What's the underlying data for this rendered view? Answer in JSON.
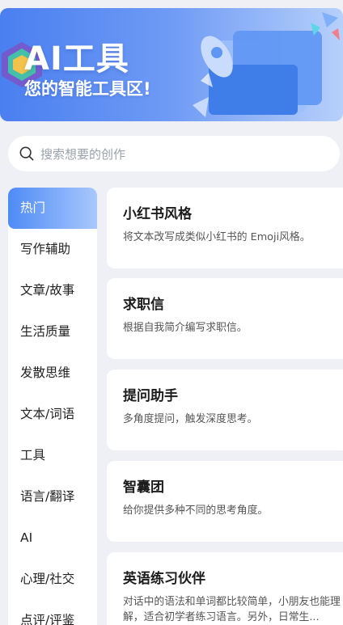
{
  "banner": {
    "title": "AI工具",
    "subtitle": "您的智能工具区!"
  },
  "search": {
    "placeholder": "搜索想要的创作"
  },
  "sidebar": {
    "items": [
      {
        "label": "热门",
        "active": true
      },
      {
        "label": "写作辅助"
      },
      {
        "label": "文章/故事"
      },
      {
        "label": "生活质量"
      },
      {
        "label": "发散思维"
      },
      {
        "label": "文本/词语"
      },
      {
        "label": "工具"
      },
      {
        "label": "语言/翻译"
      },
      {
        "label": "AI"
      },
      {
        "label": "心理/社交"
      },
      {
        "label": "点评/评鉴"
      }
    ]
  },
  "cards": [
    {
      "title": "小红书风格",
      "desc": "将文本改写成类似小红书的 Emoji风格。"
    },
    {
      "title": "求职信",
      "desc": "根据自我简介编写求职信。"
    },
    {
      "title": "提问助手",
      "desc": "多角度提问，触发深度思考。"
    },
    {
      "title": "智囊团",
      "desc": "给你提供多种不同的思考角度。"
    },
    {
      "title": "英语练习伙伴",
      "desc": "对话中的语法和单词都比较简单，小朋友也能理解，适合初学者练习语言。另外，日常生..."
    }
  ],
  "colors": {
    "accent": "#4e8bf7",
    "background": "#eef0f5"
  }
}
